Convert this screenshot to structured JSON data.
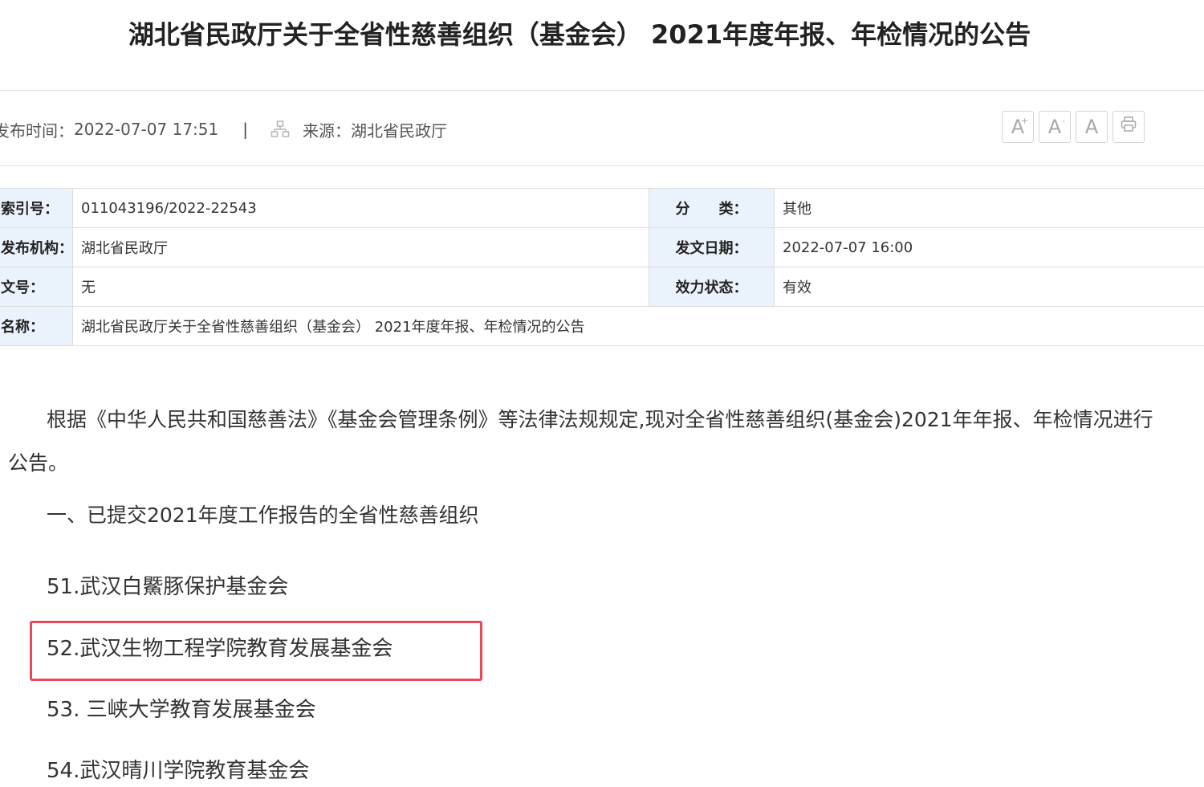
{
  "article": {
    "title": "湖北省民政厅关于全省性慈善组织（基金会） 2021年度年报、年检情况的公告",
    "publish_label": "发布时间：",
    "publish_time": "2022-07-07 17:51",
    "separator": "|",
    "source_label": "来源：",
    "source": "湖北省民政厅",
    "source_icon": "sitemap-icon"
  },
  "toolbar": {
    "font_larger": "A",
    "font_larger_mark": "+",
    "font_smaller": "A",
    "font_smaller_mark": "-",
    "font_default": "A",
    "print_icon": "printer-icon"
  },
  "info_table": {
    "rows": [
      {
        "k1": "索引号：",
        "v1": "011043196/2022-22543",
        "k2": "分　　类：",
        "v2": "其他"
      },
      {
        "k1": "发布机构：",
        "v1": "湖北省民政厅",
        "k2": "发文日期：",
        "v2": "2022-07-07 16:00"
      },
      {
        "k1": "文号：",
        "v1": "无",
        "k2": "效力状态：",
        "v2": "有效"
      },
      {
        "k1": "名称：",
        "v1": "湖北省民政厅关于全省性慈善组织（基金会） 2021年度年报、年检情况的公告"
      }
    ]
  },
  "body": {
    "intro": "根据《中华人民共和国慈善法》《基金会管理条例》等法律法规规定,现对全省性慈善组织(基金会)2021年年报、年检情况进行公告。",
    "section_1": "一、已提交2021年度工作报告的全省性慈善组织",
    "orgs": [
      "51.武汉白鱀豚保护基金会",
      "52.武汉生物工程学院教育发展基金会",
      "53. 三峡大学教育发展基金会",
      "54.武汉晴川学院教育基金会"
    ]
  },
  "colors": {
    "highlight_border": "#e8475c",
    "table_key_bg": "#eaf2fb"
  }
}
